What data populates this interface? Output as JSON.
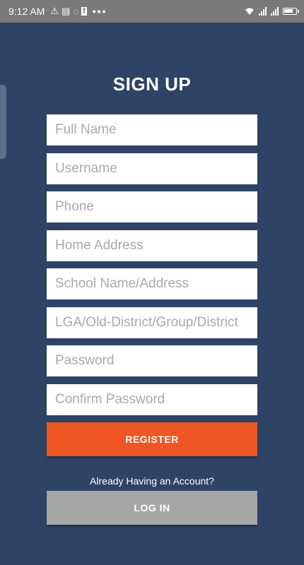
{
  "status_bar": {
    "time": "9:12 AM",
    "notification_icons": [
      "warning-icon",
      "message-icon",
      "whatsapp-icon",
      "facebook-icon"
    ],
    "more_indicator": "•••",
    "right_icons": [
      "wifi-icon",
      "signal-icon",
      "signal-icon",
      "battery-icon"
    ]
  },
  "page": {
    "title": "SIGN UP"
  },
  "form": {
    "full_name_placeholder": "Full Name",
    "username_placeholder": "Username",
    "phone_placeholder": "Phone",
    "home_address_placeholder": "Home Address",
    "school_placeholder": "School Name/Address",
    "lga_placeholder": "LGA/Old-District/Group/District",
    "password_placeholder": "Password",
    "confirm_password_placeholder": "Confirm Password"
  },
  "actions": {
    "register_label": "REGISTER",
    "account_prompt": "Already Having an Account?",
    "login_label": "LOG IN"
  },
  "colors": {
    "background": "#2e4366",
    "register_button": "#ef5625",
    "login_button": "#a6a6a6",
    "status_bar": "#7a7a7a"
  }
}
